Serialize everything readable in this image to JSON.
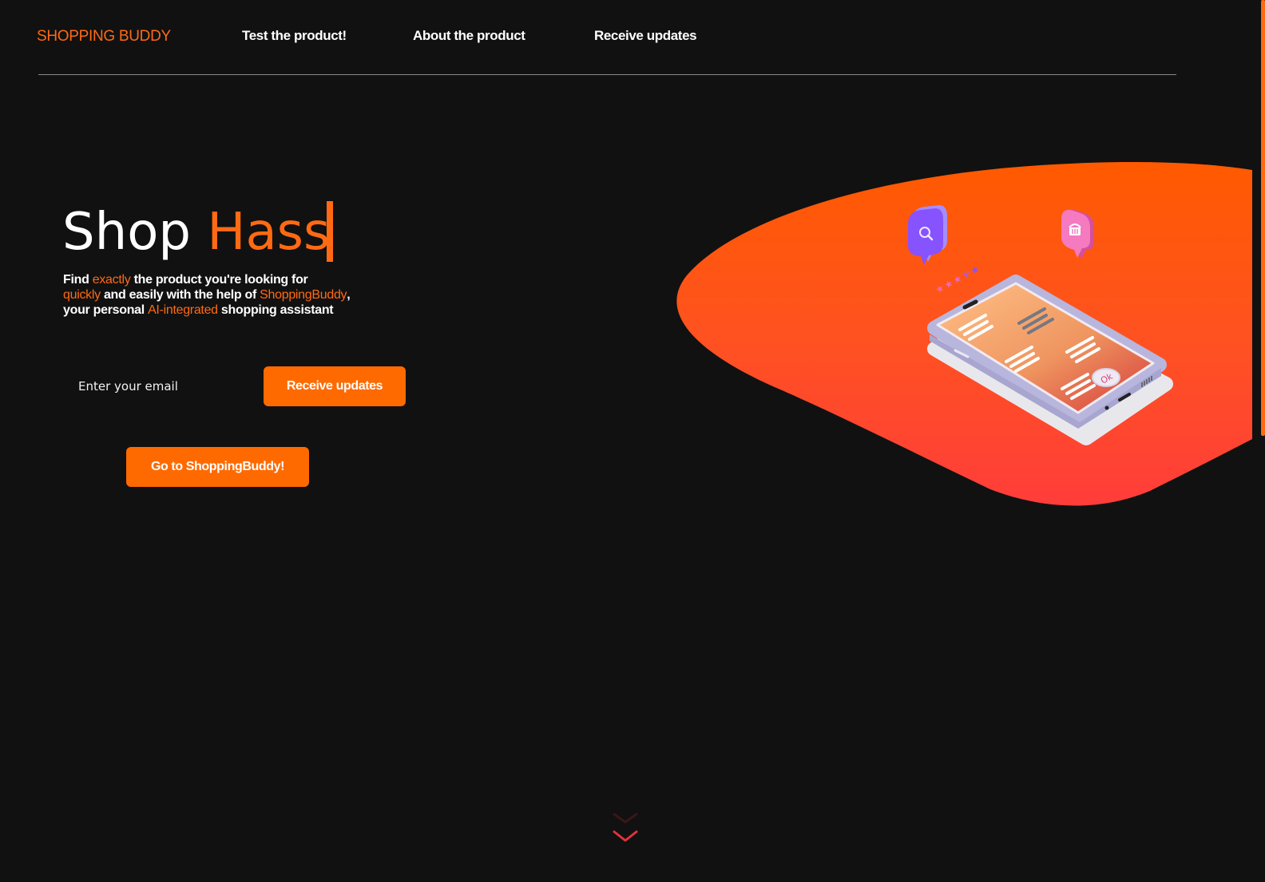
{
  "nav": {
    "logo": "SHOPPING BUDDY",
    "links": [
      {
        "label": "Test the product!"
      },
      {
        "label": "About the product"
      },
      {
        "label": "Receive updates"
      }
    ]
  },
  "hero": {
    "title_white": "Shop",
    "title_orange": "Hass",
    "subtitle": {
      "line1": [
        {
          "text": "Find ",
          "highlight": false
        },
        {
          "text": "exactly",
          "highlight": true
        },
        {
          "text": " the product you're looking for",
          "highlight": false
        }
      ],
      "line2": [
        {
          "text": "quickly",
          "highlight": true
        },
        {
          "text": " and easily with the help of ",
          "highlight": false
        },
        {
          "text": "ShoppingBuddy",
          "highlight": true
        },
        {
          "text": ",",
          "highlight": false
        }
      ],
      "line3": [
        {
          "text": "your personal ",
          "highlight": false
        },
        {
          "text": "AI-integrated",
          "highlight": true
        },
        {
          "text": " shopping assistant",
          "highlight": false
        }
      ]
    },
    "email_placeholder": "Enter your email",
    "email_value": "",
    "receive_updates_button": "Receive updates",
    "go_button": "Go to ShoppingBuddy!"
  },
  "illustration": {
    "bubble_left_icon": "search-icon",
    "bubble_right_icon": "basket-icon",
    "ok_badge": "Ok",
    "rating_stars": 5
  },
  "scroll_indicator": "chevron-double-down-icon",
  "colors": {
    "background": "#111111",
    "accent": "#ff6a13",
    "button": "#ff6a00",
    "blob_top": "#ff5a00",
    "blob_bottom": "#ff3d3d",
    "bubble_purple": "#8b5cf6",
    "bubble_pink": "#f472b6",
    "chevron": "#e0323c"
  }
}
